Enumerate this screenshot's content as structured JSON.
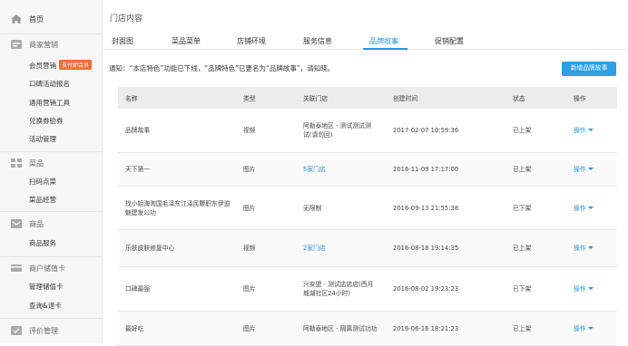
{
  "sidebar": {
    "home": "首页",
    "sections": [
      {
        "title": "商家营销",
        "icon": "marketing-icon",
        "items": [
          "会员营销",
          "口碑活动报名",
          "通用营销工具",
          "兑换券验券",
          "活动管理"
        ],
        "badge": "支付即会员"
      },
      {
        "title": "菜品",
        "icon": "grid-icon",
        "items": [
          "扫码点菜",
          "菜品经营"
        ]
      },
      {
        "title": "商品",
        "icon": "goods-icon",
        "items": [
          "商品服务"
        ]
      },
      {
        "title": "商户储值卡",
        "icon": "card-icon",
        "items": [
          "管理储值卡",
          "查询&退卡"
        ]
      },
      {
        "title": "评价管理",
        "icon": "review-icon",
        "items": []
      }
    ]
  },
  "main": {
    "title": "门店内容",
    "tabs": [
      "封面图",
      "菜品菜单",
      "店铺环境",
      "服务信息",
      "品牌故事",
      "促销配置"
    ],
    "active_tab": 4,
    "notice": "通知：“本店特色”功能已下线，“品牌特色”已更名为“品牌故事”，请知晓。",
    "new_button": "新增品牌故事"
  },
  "table": {
    "headers": [
      "名称",
      "类型",
      "关联门店",
      "创建时间",
      "状态",
      "操作"
    ],
    "rows": [
      {
        "name": "品牌故事",
        "type": "视频",
        "store": "阿勒泰地区 - 测试测试测试(请勿回)",
        "store_link": false,
        "time": "2017-02-07 10:59:36",
        "status": "已上架",
        "op": "操作"
      },
      {
        "name": "天下第一",
        "type": "图片",
        "store": "5家门店",
        "store_link": true,
        "time": "2016-11-09 17:17:00",
        "status": "已上架",
        "op": "操作"
      },
      {
        "name": "找小姐海淘国毛泽东江泽民鞭职东伊迫魅建发公功",
        "type": "图片",
        "store": "无限制",
        "store_link": false,
        "time": "2016-09-13 21:55:38",
        "status": "已下架",
        "op": "操作"
      },
      {
        "name": "乐肤皮肤修复中心",
        "type": "视频",
        "store": "2家门店",
        "store_link": true,
        "time": "2016-08-18 19:14:35",
        "status": "已上架",
        "op": "操作"
      },
      {
        "name": "口碑最强",
        "type": "图片",
        "store": "兴安盟 - 测试店店店(西月城湖社区24小时)",
        "store_link": false,
        "time": "2016-08-02 19:23:23",
        "status": "已下架",
        "op": "操作"
      },
      {
        "name": "最好吃",
        "type": "图片",
        "store": "阿勒泰地区 - 隔离测试功功",
        "store_link": false,
        "time": "2016-06-16 18:21:23",
        "status": "已上架",
        "op": "操作"
      }
    ]
  }
}
